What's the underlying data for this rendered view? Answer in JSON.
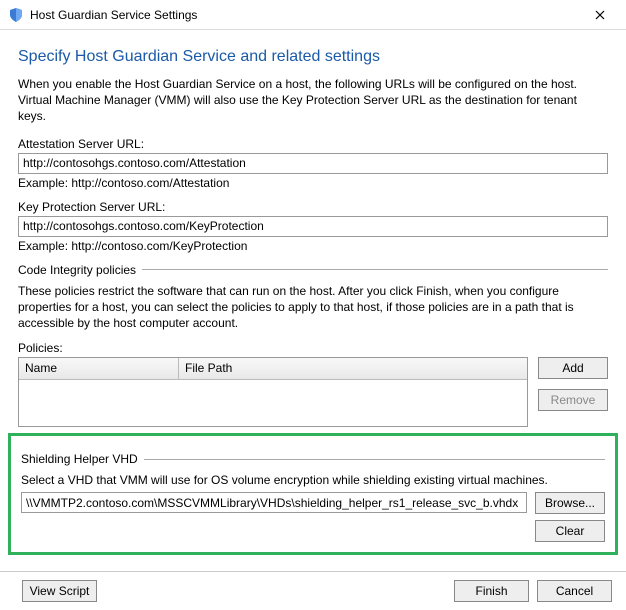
{
  "window": {
    "title": "Host Guardian Service Settings"
  },
  "heading": "Specify Host Guardian Service and related settings",
  "intro": "When you enable the Host Guardian Service on a host, the following URLs will be configured on the host. Virtual Machine Manager (VMM) will also use the Key Protection Server URL as the destination for tenant keys.",
  "attestation": {
    "label": "Attestation Server URL:",
    "value": "http://contosohgs.contoso.com/Attestation",
    "example": "Example: http://contoso.com/Attestation"
  },
  "keyprotection": {
    "label": "Key Protection Server URL:",
    "value": "http://contosohgs.contoso.com/KeyProtection",
    "example": "Example: http://contoso.com/KeyProtection"
  },
  "code_integrity": {
    "label": "Code Integrity policies",
    "desc": "These policies restrict the software that can run on the host. After you click Finish, when you configure properties for a host, you can select the policies to apply to that host, if those policies are in a path that is accessible by the host computer account."
  },
  "policies": {
    "label": "Policies:",
    "columns": {
      "name": "Name",
      "path": "File Path"
    },
    "rows": [],
    "add": "Add",
    "remove": "Remove"
  },
  "helper": {
    "label": "Shielding Helper VHD",
    "desc": "Select a VHD that VMM will use for OS volume encryption while shielding existing virtual machines.",
    "value": "\\\\VMMTP2.contoso.com\\MSSCVMMLibrary\\VHDs\\shielding_helper_rs1_release_svc_b.vhdx",
    "browse": "Browse...",
    "clear": "Clear"
  },
  "footer": {
    "view_script": "View Script",
    "finish": "Finish",
    "cancel": "Cancel"
  }
}
